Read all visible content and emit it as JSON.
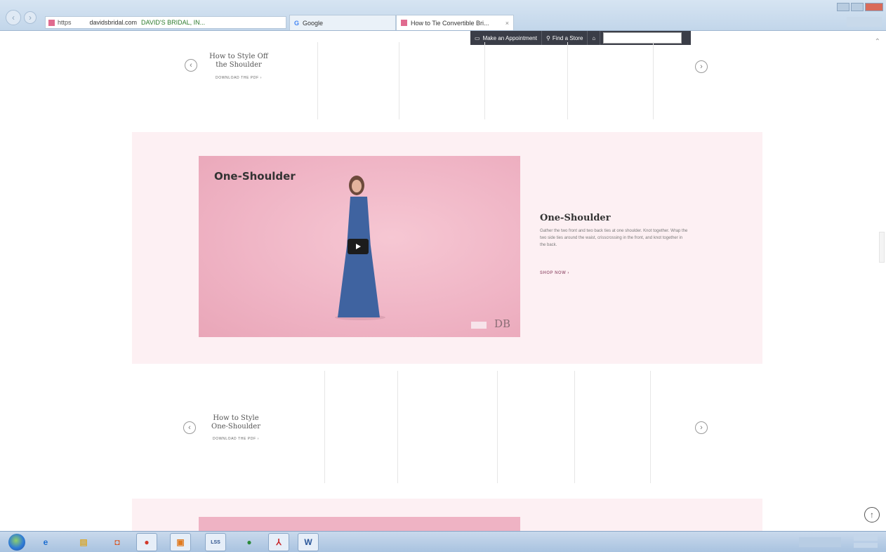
{
  "browser": {
    "address": {
      "protocol": "https",
      "domain": "davidsbridal.com",
      "site_security": "DAVID'S BRIDAL, IN..."
    },
    "tabs": [
      {
        "label": "Google",
        "favicon": "google-icon"
      },
      {
        "label": "How to Tie Convertible Bri...",
        "favicon": "site-favicon"
      }
    ]
  },
  "site_bar": {
    "appointment": "Make an Appointment",
    "find_store": "Find a Store"
  },
  "carousel_top": {
    "title_line1": "How to Style Off",
    "title_line2": "the Shoulder",
    "link": "DOWNLOAD THE PDF ›"
  },
  "feature": {
    "video_title": "One-Shoulder",
    "video_watermark": "DB",
    "heading": "One-Shoulder",
    "body": "Gather the two front and two back ties at one shoulder. Knot together. Wrap the two side ties around the waist, crisscrossing in the front, and knot together in the back.",
    "link": "SHOP NOW ›"
  },
  "carousel_bottom": {
    "title_line1": "How to Style",
    "title_line2": "One-Shoulder",
    "link": "DOWNLOAD THE PDF ›"
  },
  "taskbar": {
    "apps": [
      "ie-icon",
      "explorer-icon",
      "office-icon",
      "chrome-icon",
      "outlook-icon",
      "lss-icon",
      "spotify-icon",
      "acrobat-icon",
      "word-icon"
    ],
    "lss_label": "LSS",
    "word_label": "W"
  },
  "colors": {
    "feature_bg": "#fdf0f3",
    "video_bg": "#efb3c4",
    "dress": "#3f63a0",
    "site_bar": "#3a3d47"
  }
}
